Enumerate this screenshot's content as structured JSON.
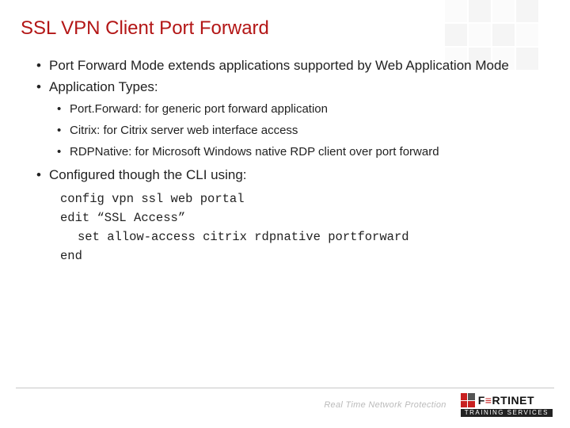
{
  "title": "SSL VPN  Client Port Forward",
  "bullets": {
    "l1_0": "Port Forward Mode extends applications supported by Web Application Mode",
    "l1_1": "Application Types:",
    "l2_0": "Port.Forward: for generic port forward application",
    "l2_1": "Citrix: for Citrix server web interface access",
    "l2_2": "RDPNative: for Microsoft Windows native RDP client over port forward",
    "l1_2": "Configured though the CLI using:"
  },
  "code": {
    "line0": "config vpn ssl web portal",
    "line1": "edit “SSL Access”",
    "line2": "set allow-access citrix rdpnative portforward",
    "line3": "end"
  },
  "footer": {
    "tagline": "Real Time Network Protection",
    "logo_name_left": "F",
    "logo_name_mid": "≡",
    "logo_name_right": "RTINET",
    "logo_sub": "TRAINING SERVICES"
  }
}
